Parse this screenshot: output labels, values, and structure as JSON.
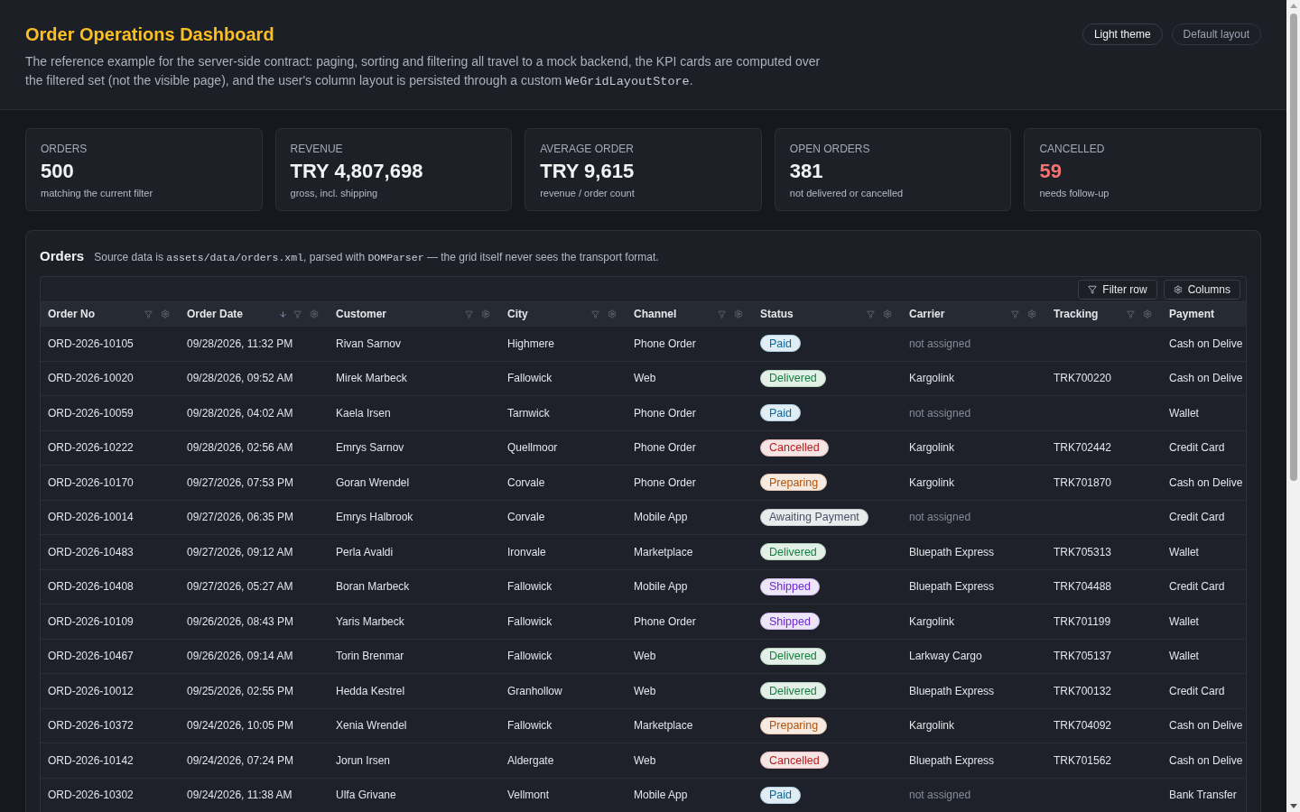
{
  "header": {
    "title": "Order Operations Dashboard",
    "description": [
      {
        "kind": "text",
        "text": "The reference example for the server-side contract: paging, sorting and filtering all travel to a mock backend, the KPI cards are computed over the filtered set (not the visible page), and the user's column layout is persisted through a custom "
      },
      {
        "kind": "code",
        "text": "WeGridLayoutStore"
      },
      {
        "kind": "text",
        "text": "."
      }
    ],
    "buttons": [
      {
        "label": "Light theme",
        "kind": "primary"
      },
      {
        "label": "Default layout",
        "kind": "secondary"
      }
    ]
  },
  "kpis": [
    {
      "label": "ORDERS",
      "value": "500",
      "note": "matching the current filter",
      "alert": false
    },
    {
      "label": "REVENUE",
      "value": "TRY 4,807,698",
      "note": "gross, incl. shipping",
      "alert": false
    },
    {
      "label": "AVERAGE ORDER",
      "value": "TRY 9,615",
      "note": "revenue / order count",
      "alert": false
    },
    {
      "label": "OPEN ORDERS",
      "value": "381",
      "note": "not delivered or cancelled",
      "alert": false
    },
    {
      "label": "CANCELLED",
      "value": "59",
      "note": "needs follow-up",
      "alert": true
    }
  ],
  "orders": {
    "title": "Orders",
    "description": [
      {
        "kind": "text",
        "text": "Source data is "
      },
      {
        "kind": "code",
        "text": "assets/data/orders.xml"
      },
      {
        "kind": "text",
        "text": ", parsed with "
      },
      {
        "kind": "code",
        "text": "DOMParser"
      },
      {
        "kind": "text",
        "text": " — the grid itself never sees the transport format."
      }
    ],
    "toolbar": [
      {
        "label": "Filter row",
        "kind": "filter"
      },
      {
        "label": "Columns",
        "kind": "columns"
      }
    ],
    "columns": [
      {
        "label": "Order No",
        "menu": true
      },
      {
        "label": "Order Date",
        "menu": true,
        "sorted_descending": true
      },
      {
        "label": "Customer",
        "menu": true
      },
      {
        "label": "City",
        "menu": true
      },
      {
        "label": "Channel",
        "menu": true
      },
      {
        "label": "Status",
        "menu": true
      },
      {
        "label": "Carrier",
        "menu": true
      },
      {
        "label": "Tracking",
        "menu": true
      },
      {
        "label": "Payment",
        "menu": false
      }
    ],
    "rows": [
      {
        "order_no": "ORD-2026-10105",
        "order_date": "09/28/2026, 11:32 PM",
        "customer": "Rivan Sarnov",
        "city": "Highmere",
        "channel": "Phone Order",
        "status": {
          "label": "Paid",
          "color": "#0369a1"
        },
        "carrier": "not assigned",
        "carrier_assigned": false,
        "payment": "Cash on Delive"
      },
      {
        "order_no": "ORD-2026-10020",
        "order_date": "09/28/2026, 09:52 AM",
        "customer": "Mirek Marbeck",
        "city": "Fallowick",
        "channel": "Web",
        "status": {
          "label": "Delivered",
          "color": "#15803d"
        },
        "carrier": "Kargolink",
        "carrier_assigned": true,
        "tracking": "TRK700220",
        "payment": "Cash on Delive"
      },
      {
        "order_no": "ORD-2026-10059",
        "order_date": "09/28/2026, 04:02 AM",
        "customer": "Kaela Irsen",
        "city": "Tarnwick",
        "channel": "Phone Order",
        "status": {
          "label": "Paid",
          "color": "#0369a1"
        },
        "carrier": "not assigned",
        "carrier_assigned": false,
        "payment": "Wallet"
      },
      {
        "order_no": "ORD-2026-10222",
        "order_date": "09/28/2026, 02:56 AM",
        "customer": "Emrys Sarnov",
        "city": "Quellmoor",
        "channel": "Phone Order",
        "status": {
          "label": "Cancelled",
          "color": "#b91c1c"
        },
        "carrier": "Kargolink",
        "carrier_assigned": true,
        "tracking": "TRK702442",
        "payment": "Credit Card"
      },
      {
        "order_no": "ORD-2026-10170",
        "order_date": "09/27/2026, 07:53 PM",
        "customer": "Goran Wrendel",
        "city": "Corvale",
        "channel": "Phone Order",
        "status": {
          "label": "Preparing",
          "color": "#b45309"
        },
        "carrier": "Kargolink",
        "carrier_assigned": true,
        "tracking": "TRK701870",
        "payment": "Cash on Delive"
      },
      {
        "order_no": "ORD-2026-10014",
        "order_date": "09/27/2026, 06:35 PM",
        "customer": "Emrys Halbrook",
        "city": "Corvale",
        "channel": "Mobile App",
        "status": {
          "label": "Awaiting Payment",
          "color": "#475569"
        },
        "carrier": "not assigned",
        "carrier_assigned": false,
        "payment": "Credit Card"
      },
      {
        "order_no": "ORD-2026-10483",
        "order_date": "09/27/2026, 09:12 AM",
        "customer": "Perla Avaldi",
        "city": "Ironvale",
        "channel": "Marketplace",
        "status": {
          "label": "Delivered",
          "color": "#15803d"
        },
        "carrier": "Bluepath Express",
        "carrier_assigned": true,
        "tracking": "TRK705313",
        "payment": "Wallet"
      },
      {
        "order_no": "ORD-2026-10408",
        "order_date": "09/27/2026, 05:27 AM",
        "customer": "Boran Marbeck",
        "city": "Fallowick",
        "channel": "Mobile App",
        "status": {
          "label": "Shipped",
          "color": "#6d28d9"
        },
        "carrier": "Bluepath Express",
        "carrier_assigned": true,
        "tracking": "TRK704488",
        "payment": "Credit Card"
      },
      {
        "order_no": "ORD-2026-10109",
        "order_date": "09/26/2026, 08:43 PM",
        "customer": "Yaris Marbeck",
        "city": "Fallowick",
        "channel": "Phone Order",
        "status": {
          "label": "Shipped",
          "color": "#6d28d9"
        },
        "carrier": "Kargolink",
        "carrier_assigned": true,
        "tracking": "TRK701199",
        "payment": "Wallet"
      },
      {
        "order_no": "ORD-2026-10467",
        "order_date": "09/26/2026, 09:14 AM",
        "customer": "Torin Brenmar",
        "city": "Fallowick",
        "channel": "Web",
        "status": {
          "label": "Delivered",
          "color": "#15803d"
        },
        "carrier": "Larkway Cargo",
        "carrier_assigned": true,
        "tracking": "TRK705137",
        "payment": "Wallet"
      },
      {
        "order_no": "ORD-2026-10012",
        "order_date": "09/25/2026, 02:55 PM",
        "customer": "Hedda Kestrel",
        "city": "Granhollow",
        "channel": "Web",
        "status": {
          "label": "Delivered",
          "color": "#15803d"
        },
        "carrier": "Bluepath Express",
        "carrier_assigned": true,
        "tracking": "TRK700132",
        "payment": "Credit Card"
      },
      {
        "order_no": "ORD-2026-10372",
        "order_date": "09/24/2026, 10:05 PM",
        "customer": "Xenia Wrendel",
        "city": "Fallowick",
        "channel": "Marketplace",
        "status": {
          "label": "Preparing",
          "color": "#b45309"
        },
        "carrier": "Kargolink",
        "carrier_assigned": true,
        "tracking": "TRK704092",
        "payment": "Cash on Delive"
      },
      {
        "order_no": "ORD-2026-10142",
        "order_date": "09/24/2026, 07:24 PM",
        "customer": "Jorun Irsen",
        "city": "Aldergate",
        "channel": "Web",
        "status": {
          "label": "Cancelled",
          "color": "#b91c1c"
        },
        "carrier": "Bluepath Express",
        "carrier_assigned": true,
        "tracking": "TRK701562",
        "payment": "Cash on Delive"
      },
      {
        "order_no": "ORD-2026-10302",
        "order_date": "09/24/2026, 11:38 AM",
        "customer": "Ulfa Grivane",
        "city": "Vellmont",
        "channel": "Mobile App",
        "status": {
          "label": "Paid",
          "color": "#0369a1"
        },
        "carrier": "not assigned",
        "carrier_assigned": false,
        "payment": "Bank Transfer"
      }
    ]
  }
}
